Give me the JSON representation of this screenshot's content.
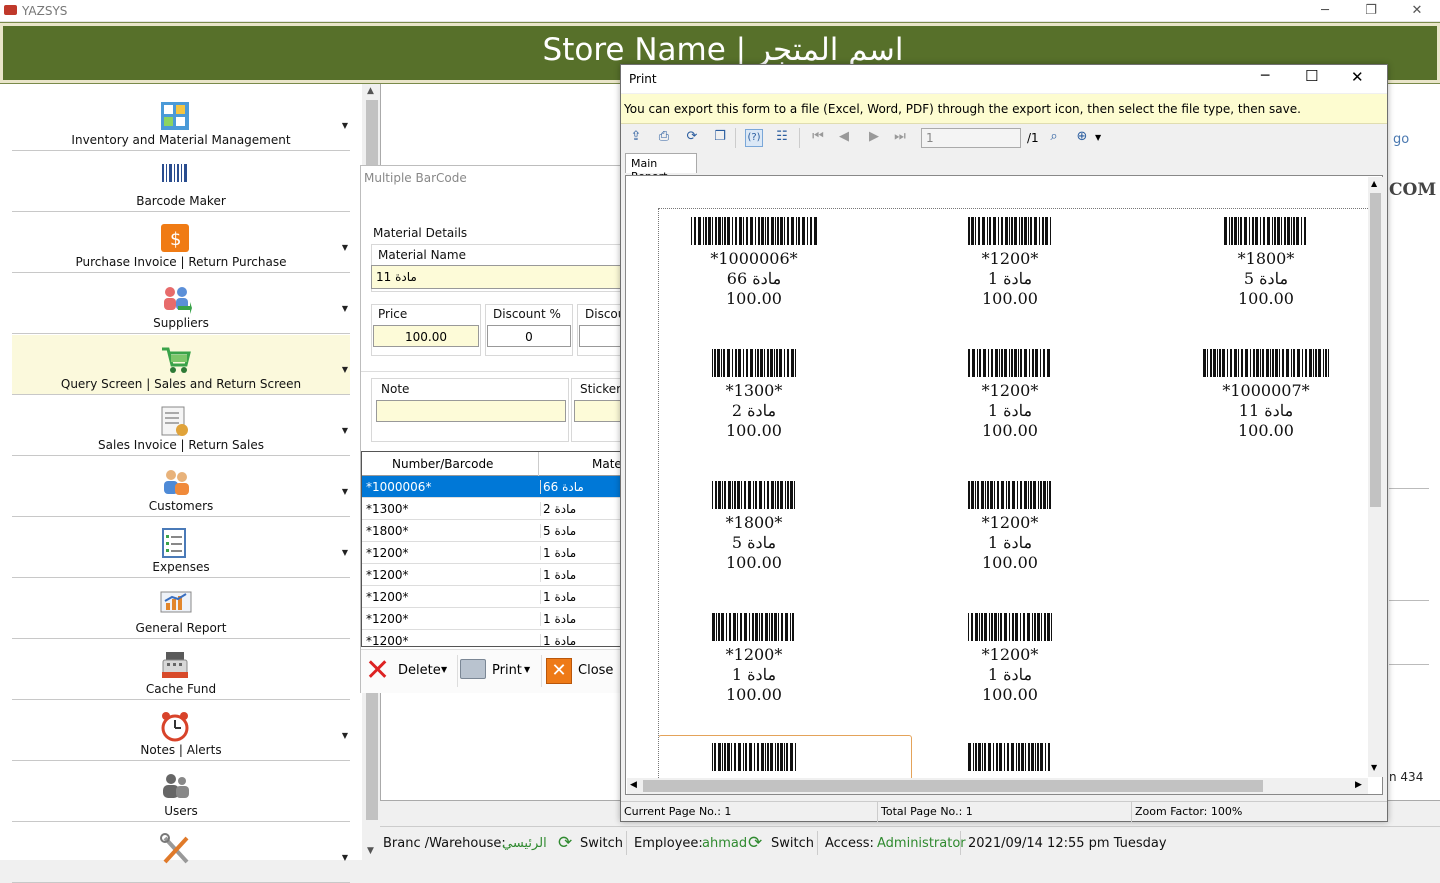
{
  "app": {
    "title": "YAZSYS",
    "store_name": "Store Name | اسم المتجر"
  },
  "sidebar": {
    "items": [
      {
        "label": "Inventory and Material Management",
        "icon": "inventory-icon",
        "arrow": true
      },
      {
        "label": "Barcode Maker",
        "icon": "barcode-icon",
        "arrow": false
      },
      {
        "label": "Purchase Invoice | Return Purchase",
        "icon": "purchase-icon",
        "arrow": true
      },
      {
        "label": "Suppliers",
        "icon": "suppliers-icon",
        "arrow": true
      },
      {
        "label": "Query Screen | Sales and Return Screen",
        "icon": "cart-icon",
        "arrow": true,
        "selected": true
      },
      {
        "label": "Sales Invoice | Return Sales",
        "icon": "invoice-icon",
        "arrow": true
      },
      {
        "label": "Customers",
        "icon": "customers-icon",
        "arrow": true
      },
      {
        "label": "Expenses",
        "icon": "expenses-icon",
        "arrow": true
      },
      {
        "label": "General Report",
        "icon": "report-icon",
        "arrow": false
      },
      {
        "label": "Cache Fund",
        "icon": "cash-register-icon",
        "arrow": false
      },
      {
        "label": "Notes | Alerts",
        "icon": "alarm-clock-icon",
        "arrow": true
      },
      {
        "label": "Users",
        "icon": "users-icon",
        "arrow": false
      },
      {
        "label": "",
        "icon": "tools-icon",
        "arrow": true
      }
    ]
  },
  "background": {
    "partial_texts": [
      "go",
      "COM",
      "n 434"
    ]
  },
  "status": {
    "branch_label": "Branc /Warehouse:",
    "branch_value": "الرئيسي",
    "switch1": "Switch",
    "employee_label": "Employee:",
    "employee_value": "ahmad",
    "switch2": "Switch",
    "access_label": "Access:",
    "access_value": "Administrator",
    "datetime": "2021/09/14 12:55 pm Tuesday"
  },
  "multibarcode": {
    "title": "Multiple BarCode",
    "material_details": "Material Details",
    "material_name_label": "Material Name",
    "material_name_value": "مادة 11",
    "price_label": "Price",
    "price_value": "100.00",
    "discount_pct_label": "Discount %",
    "discount_pct_value": "0",
    "discount_label": "Discou",
    "note_label": "Note",
    "stickers_label": "Stickers",
    "grid_headers": [
      "Number/Barcode",
      "Mate"
    ],
    "rows": [
      {
        "barcode": "*1000006*",
        "material": "مادة 66"
      },
      {
        "barcode": "*1300*",
        "material": "مادة 2"
      },
      {
        "barcode": "*1800*",
        "material": "مادة 5"
      },
      {
        "barcode": "*1200*",
        "material": "مادة 1"
      },
      {
        "barcode": "*1200*",
        "material": "مادة 1"
      },
      {
        "barcode": "*1200*",
        "material": "مادة 1"
      },
      {
        "barcode": "*1200*",
        "material": "مادة 1"
      },
      {
        "barcode": "*1200*",
        "material": "مادة 1"
      }
    ],
    "delete_label": "Delete",
    "print_label": "Print",
    "close_label": "Close"
  },
  "print": {
    "title": "Print",
    "info": "You can export this form to a file (Excel, Word, PDF) through the export icon, then select the file type, then save.",
    "page_input": "1",
    "page_total": "/1",
    "tab": "Main Report",
    "labels": [
      {
        "code": "*1000006*",
        "name": "مادة 66",
        "price": "100.00"
      },
      {
        "code": "*1200*",
        "name": "مادة 1",
        "price": "100.00"
      },
      {
        "code": "*1800*",
        "name": "مادة 5",
        "price": "100.00"
      },
      {
        "code": "*1300*",
        "name": "مادة 2",
        "price": "100.00"
      },
      {
        "code": "*1200*",
        "name": "مادة 1",
        "price": "100.00"
      },
      {
        "code": "*1000007*",
        "name": "مادة 11",
        "price": "100.00"
      },
      {
        "code": "*1800*",
        "name": "مادة 5",
        "price": "100.00"
      },
      {
        "code": "*1200*",
        "name": "مادة 1",
        "price": "100.00"
      },
      {
        "code": "*1200*",
        "name": "مادة 1",
        "price": "100.00"
      },
      {
        "code": "*1200*",
        "name": "مادة 1",
        "price": "100.00"
      }
    ],
    "current_page": "Current Page No.: 1",
    "total_page": "Total Page No.: 1",
    "zoom": "Zoom Factor: 100%"
  }
}
